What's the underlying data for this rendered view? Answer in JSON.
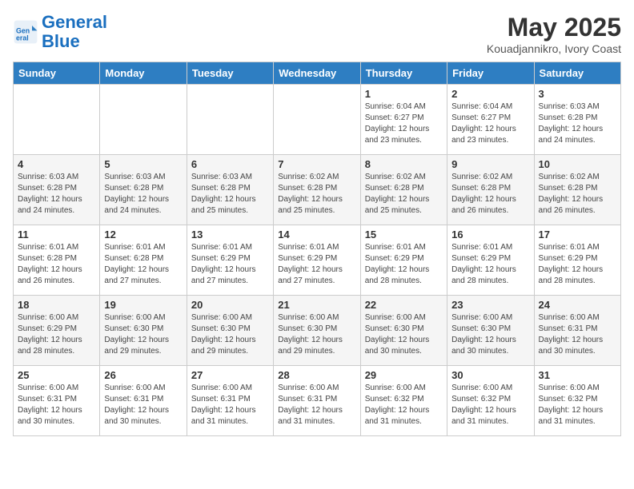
{
  "header": {
    "logo_line1": "General",
    "logo_line2": "Blue",
    "month_title": "May 2025",
    "subtitle": "Kouadjannikro, Ivory Coast"
  },
  "weekdays": [
    "Sunday",
    "Monday",
    "Tuesday",
    "Wednesday",
    "Thursday",
    "Friday",
    "Saturday"
  ],
  "weeks": [
    [
      {
        "day": "",
        "info": ""
      },
      {
        "day": "",
        "info": ""
      },
      {
        "day": "",
        "info": ""
      },
      {
        "day": "",
        "info": ""
      },
      {
        "day": "1",
        "info": "Sunrise: 6:04 AM\nSunset: 6:27 PM\nDaylight: 12 hours\nand 23 minutes."
      },
      {
        "day": "2",
        "info": "Sunrise: 6:04 AM\nSunset: 6:27 PM\nDaylight: 12 hours\nand 23 minutes."
      },
      {
        "day": "3",
        "info": "Sunrise: 6:03 AM\nSunset: 6:28 PM\nDaylight: 12 hours\nand 24 minutes."
      }
    ],
    [
      {
        "day": "4",
        "info": "Sunrise: 6:03 AM\nSunset: 6:28 PM\nDaylight: 12 hours\nand 24 minutes."
      },
      {
        "day": "5",
        "info": "Sunrise: 6:03 AM\nSunset: 6:28 PM\nDaylight: 12 hours\nand 24 minutes."
      },
      {
        "day": "6",
        "info": "Sunrise: 6:03 AM\nSunset: 6:28 PM\nDaylight: 12 hours\nand 25 minutes."
      },
      {
        "day": "7",
        "info": "Sunrise: 6:02 AM\nSunset: 6:28 PM\nDaylight: 12 hours\nand 25 minutes."
      },
      {
        "day": "8",
        "info": "Sunrise: 6:02 AM\nSunset: 6:28 PM\nDaylight: 12 hours\nand 25 minutes."
      },
      {
        "day": "9",
        "info": "Sunrise: 6:02 AM\nSunset: 6:28 PM\nDaylight: 12 hours\nand 26 minutes."
      },
      {
        "day": "10",
        "info": "Sunrise: 6:02 AM\nSunset: 6:28 PM\nDaylight: 12 hours\nand 26 minutes."
      }
    ],
    [
      {
        "day": "11",
        "info": "Sunrise: 6:01 AM\nSunset: 6:28 PM\nDaylight: 12 hours\nand 26 minutes."
      },
      {
        "day": "12",
        "info": "Sunrise: 6:01 AM\nSunset: 6:28 PM\nDaylight: 12 hours\nand 27 minutes."
      },
      {
        "day": "13",
        "info": "Sunrise: 6:01 AM\nSunset: 6:29 PM\nDaylight: 12 hours\nand 27 minutes."
      },
      {
        "day": "14",
        "info": "Sunrise: 6:01 AM\nSunset: 6:29 PM\nDaylight: 12 hours\nand 27 minutes."
      },
      {
        "day": "15",
        "info": "Sunrise: 6:01 AM\nSunset: 6:29 PM\nDaylight: 12 hours\nand 28 minutes."
      },
      {
        "day": "16",
        "info": "Sunrise: 6:01 AM\nSunset: 6:29 PM\nDaylight: 12 hours\nand 28 minutes."
      },
      {
        "day": "17",
        "info": "Sunrise: 6:01 AM\nSunset: 6:29 PM\nDaylight: 12 hours\nand 28 minutes."
      }
    ],
    [
      {
        "day": "18",
        "info": "Sunrise: 6:00 AM\nSunset: 6:29 PM\nDaylight: 12 hours\nand 28 minutes."
      },
      {
        "day": "19",
        "info": "Sunrise: 6:00 AM\nSunset: 6:30 PM\nDaylight: 12 hours\nand 29 minutes."
      },
      {
        "day": "20",
        "info": "Sunrise: 6:00 AM\nSunset: 6:30 PM\nDaylight: 12 hours\nand 29 minutes."
      },
      {
        "day": "21",
        "info": "Sunrise: 6:00 AM\nSunset: 6:30 PM\nDaylight: 12 hours\nand 29 minutes."
      },
      {
        "day": "22",
        "info": "Sunrise: 6:00 AM\nSunset: 6:30 PM\nDaylight: 12 hours\nand 30 minutes."
      },
      {
        "day": "23",
        "info": "Sunrise: 6:00 AM\nSunset: 6:30 PM\nDaylight: 12 hours\nand 30 minutes."
      },
      {
        "day": "24",
        "info": "Sunrise: 6:00 AM\nSunset: 6:31 PM\nDaylight: 12 hours\nand 30 minutes."
      }
    ],
    [
      {
        "day": "25",
        "info": "Sunrise: 6:00 AM\nSunset: 6:31 PM\nDaylight: 12 hours\nand 30 minutes."
      },
      {
        "day": "26",
        "info": "Sunrise: 6:00 AM\nSunset: 6:31 PM\nDaylight: 12 hours\nand 30 minutes."
      },
      {
        "day": "27",
        "info": "Sunrise: 6:00 AM\nSunset: 6:31 PM\nDaylight: 12 hours\nand 31 minutes."
      },
      {
        "day": "28",
        "info": "Sunrise: 6:00 AM\nSunset: 6:31 PM\nDaylight: 12 hours\nand 31 minutes."
      },
      {
        "day": "29",
        "info": "Sunrise: 6:00 AM\nSunset: 6:32 PM\nDaylight: 12 hours\nand 31 minutes."
      },
      {
        "day": "30",
        "info": "Sunrise: 6:00 AM\nSunset: 6:32 PM\nDaylight: 12 hours\nand 31 minutes."
      },
      {
        "day": "31",
        "info": "Sunrise: 6:00 AM\nSunset: 6:32 PM\nDaylight: 12 hours\nand 31 minutes."
      }
    ]
  ]
}
